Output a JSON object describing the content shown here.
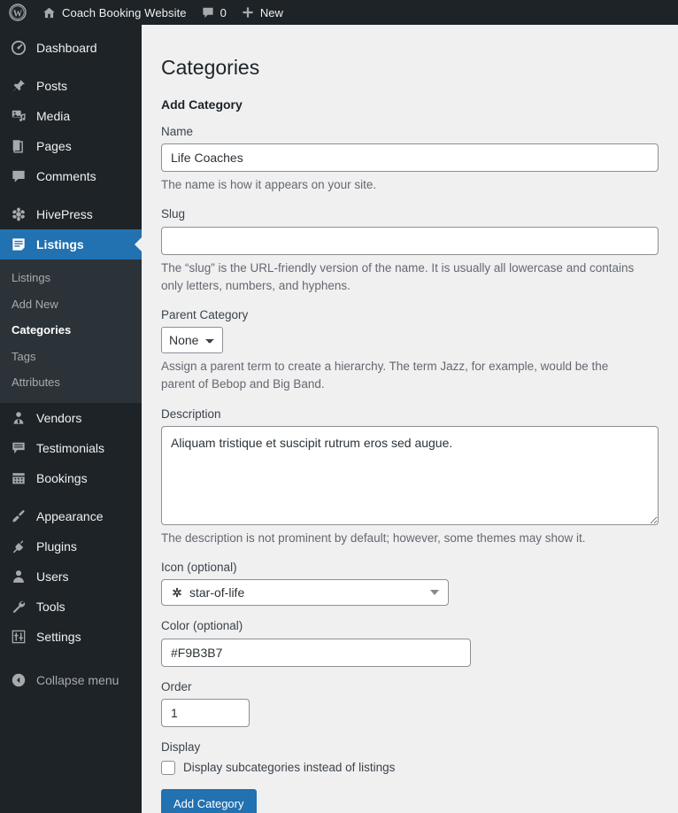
{
  "adminbar": {
    "wp_logo_icon": "wordpress-logo-icon",
    "home_icon": "home-icon",
    "site_name": "Coach Booking Website",
    "comments_icon": "comment-bubble-icon",
    "comment_count": "0",
    "new_icon": "plus-icon",
    "new_label": "New"
  },
  "sidebar": {
    "items": [
      {
        "label": "Dashboard",
        "icon": "dashboard-gauge-icon",
        "current": false
      },
      {
        "label": "Posts",
        "icon": "pushpin-icon",
        "current": false
      },
      {
        "label": "Media",
        "icon": "media-photo-music-icon",
        "current": false
      },
      {
        "label": "Pages",
        "icon": "page-document-icon",
        "current": false
      },
      {
        "label": "Comments",
        "icon": "comment-bubble-icon",
        "current": false
      },
      {
        "label": "HivePress",
        "icon": "hivepress-honeycomb-icon",
        "current": false
      },
      {
        "label": "Listings",
        "icon": "listings-lines-icon",
        "current": true
      },
      {
        "label": "Vendors",
        "icon": "user-badge-icon",
        "current": false
      },
      {
        "label": "Testimonials",
        "icon": "testimonial-quote-icon",
        "current": false
      },
      {
        "label": "Bookings",
        "icon": "calendar-icon",
        "current": false
      },
      {
        "label": "Appearance",
        "icon": "paintbrush-icon",
        "current": false
      },
      {
        "label": "Plugins",
        "icon": "plug-icon",
        "current": false
      },
      {
        "label": "Users",
        "icon": "user-icon",
        "current": false
      },
      {
        "label": "Tools",
        "icon": "wrench-icon",
        "current": false
      },
      {
        "label": "Settings",
        "icon": "sliders-icon",
        "current": false
      }
    ],
    "submenu": [
      {
        "label": "Listings",
        "current": false
      },
      {
        "label": "Add New",
        "current": false
      },
      {
        "label": "Categories",
        "current": true
      },
      {
        "label": "Tags",
        "current": false
      },
      {
        "label": "Attributes",
        "current": false
      }
    ],
    "collapse": {
      "label": "Collapse menu",
      "icon": "collapse-arrow-icon"
    },
    "colors": {
      "background": "#1d2327",
      "submenu_background": "#2c3338",
      "active": "#2271b1",
      "text": "#f0f0f1",
      "muted_text": "#a7aaad"
    }
  },
  "main": {
    "page_title": "Categories",
    "form_heading": "Add Category",
    "fields": {
      "name": {
        "label": "Name",
        "value": "Life Coaches",
        "placeholder": "",
        "description": "The name is how it appears on your site."
      },
      "slug": {
        "label": "Slug",
        "value": "",
        "placeholder": "",
        "description": "The “slug” is the URL-friendly version of the name. It is usually all lowercase and contains only letters, numbers, and hyphens."
      },
      "parent_category": {
        "label": "Parent Category",
        "value": "None",
        "options": [
          "None"
        ],
        "description": "Assign a parent term to create a hierarchy. The term Jazz, for example, would be the parent of Bebop and Big Band."
      },
      "description": {
        "label": "Description",
        "value": "Aliquam tristique et suscipit rutrum eros sed augue.",
        "placeholder": "",
        "description": "The description is not prominent by default; however, some themes may show it."
      },
      "icon": {
        "label": "Icon",
        "label_suffix": " (optional)",
        "value": "star-of-life",
        "glyph": "star-of-life-icon",
        "caret": "chevron-down-icon"
      },
      "color": {
        "label": "Color",
        "label_suffix": " (optional)",
        "value": "#F9B3B7",
        "placeholder": ""
      },
      "order": {
        "label": "Order",
        "value": "1",
        "placeholder": ""
      },
      "display": {
        "label": "Display",
        "checkbox_label": "Display subcategories instead of listings",
        "checked": false
      }
    },
    "submit_label": "Add Category"
  },
  "colors": {
    "accent": "#2271b1",
    "page_background": "#f0f0f1",
    "input_border": "#8c8f94",
    "body_text": "#1d2327",
    "muted_text": "#646970",
    "category_color_value": "#F9B3B7"
  }
}
